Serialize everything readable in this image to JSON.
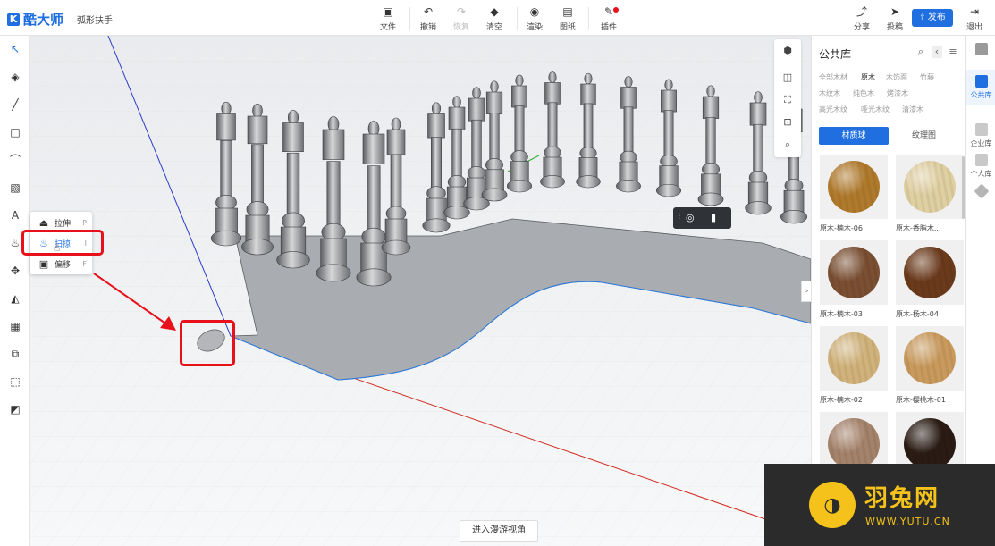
{
  "header": {
    "app_name": "酷大师",
    "logo_glyph": "K",
    "doc_title": "弧形扶手",
    "toolbar": [
      {
        "label": "文件",
        "icon": "file-icon",
        "glyph": "▣"
      },
      {
        "label": "撤销",
        "icon": "undo-icon",
        "glyph": "↶"
      },
      {
        "label": "恢复",
        "icon": "redo-icon",
        "glyph": "↷",
        "disabled": true
      },
      {
        "label": "清空",
        "icon": "eraser-icon",
        "glyph": "◆"
      },
      {
        "label": "渲染",
        "icon": "render-icon",
        "glyph": "◉"
      },
      {
        "label": "图纸",
        "icon": "drawing-icon",
        "glyph": "▤"
      },
      {
        "label": "插件",
        "icon": "plugin-icon",
        "glyph": "✎"
      }
    ],
    "right": [
      {
        "label": "分享",
        "icon": "share-icon",
        "glyph": "⤴"
      },
      {
        "label": "投稿",
        "icon": "send-icon",
        "glyph": "➤"
      }
    ],
    "publish_label": "发布",
    "exit_label": "退出"
  },
  "left_tools": [
    {
      "name": "select-icon",
      "glyph": "↖",
      "active": true
    },
    {
      "name": "paint-bucket-icon",
      "glyph": "◈"
    },
    {
      "name": "line-icon",
      "glyph": "╱"
    },
    {
      "name": "rectangle-icon",
      "glyph": "□"
    },
    {
      "name": "arc-icon",
      "glyph": "⌒"
    },
    {
      "name": "box-icon",
      "glyph": "▧"
    },
    {
      "name": "text-icon",
      "glyph": "A"
    },
    {
      "name": "loft-icon",
      "glyph": "♨"
    },
    {
      "name": "move-icon",
      "glyph": "✥"
    },
    {
      "name": "rotate-icon",
      "glyph": "◭"
    },
    {
      "name": "components-icon",
      "glyph": "▦"
    },
    {
      "name": "group-icon",
      "glyph": "⧉"
    },
    {
      "name": "dimension-icon",
      "glyph": "⬚"
    },
    {
      "name": "measure-icon",
      "glyph": "◩"
    }
  ],
  "flyout": [
    {
      "label": "拉伸",
      "key": "P",
      "glyph": "⏏"
    },
    {
      "label": "扫掠",
      "key": "I",
      "glyph": "♨"
    },
    {
      "label": "偏移",
      "key": "F",
      "glyph": "▣"
    }
  ],
  "viewport": {
    "walk_mode_label": "进入漫游视角",
    "mini_panel_icons": [
      "cube-icon",
      "box-view-icon",
      "fit-view-icon",
      "screen-icon",
      "zoom-icon"
    ],
    "accent_red": "#e8101a",
    "axis_blue": "#2a3cc8",
    "axis_red": "#d0281c"
  },
  "library": {
    "title": "公共库",
    "categories_row1": [
      "全部木材",
      "原木",
      "木饰面",
      "竹藤"
    ],
    "categories_row2": [
      "木纹木",
      "纯色木",
      "烤漆木"
    ],
    "categories_row3": [
      "高光木纹",
      "哑光木纹",
      "清漆木"
    ],
    "selected_category": "原木",
    "tabs": [
      "材质球",
      "纹理图"
    ],
    "items": [
      {
        "label": "原木-楠木-06",
        "color": "#b07a2c"
      },
      {
        "label": "原木-香脂木...",
        "color": "#e0cfa1"
      },
      {
        "label": "原木-楠木-03",
        "color": "#7a4f32"
      },
      {
        "label": "原木-杨木-04",
        "color": "#6b3a1c"
      },
      {
        "label": "原木-楠木-02",
        "color": "#d1b27a"
      },
      {
        "label": "原木-樱桃木-01",
        "color": "#c99a5c"
      },
      {
        "label": "",
        "color": "#a5826a"
      },
      {
        "label": "",
        "color": "#2a1c14"
      }
    ]
  },
  "right_rail": [
    {
      "label": "",
      "icon": "style-icon"
    },
    {
      "label": "公共库",
      "icon": "public-library-icon",
      "active": true
    },
    {
      "label": "企业库",
      "icon": "enterprise-library-icon"
    },
    {
      "label": "个人库",
      "icon": "personal-library-icon"
    },
    {
      "label": "",
      "icon": "model-icon"
    }
  ],
  "watermark": {
    "name": "羽兔网",
    "url": "WWW.YUTU.CN",
    "color": "#f4c21b"
  }
}
